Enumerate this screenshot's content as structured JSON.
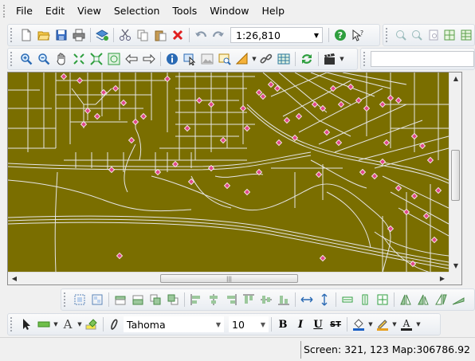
{
  "menu": {
    "items": [
      "File",
      "Edit",
      "View",
      "Selection",
      "Tools",
      "Window",
      "Help"
    ]
  },
  "toolbar_standard": {
    "scale_value": "1:26,810"
  },
  "toolbar_format": {
    "font_name": "Tahoma",
    "font_size": "10",
    "bold_label": "B",
    "italic_label": "I",
    "underline_label": "U",
    "strikethrough_label": "ST",
    "text_tool_label": "A"
  },
  "map": {
    "background_color": "#7a6e00",
    "road_color": "#e6e6e6",
    "point_color": "#e04a8a"
  },
  "status": {
    "screen_text": "Screen: 321, 123",
    "map_text": "Map:306786.92"
  }
}
